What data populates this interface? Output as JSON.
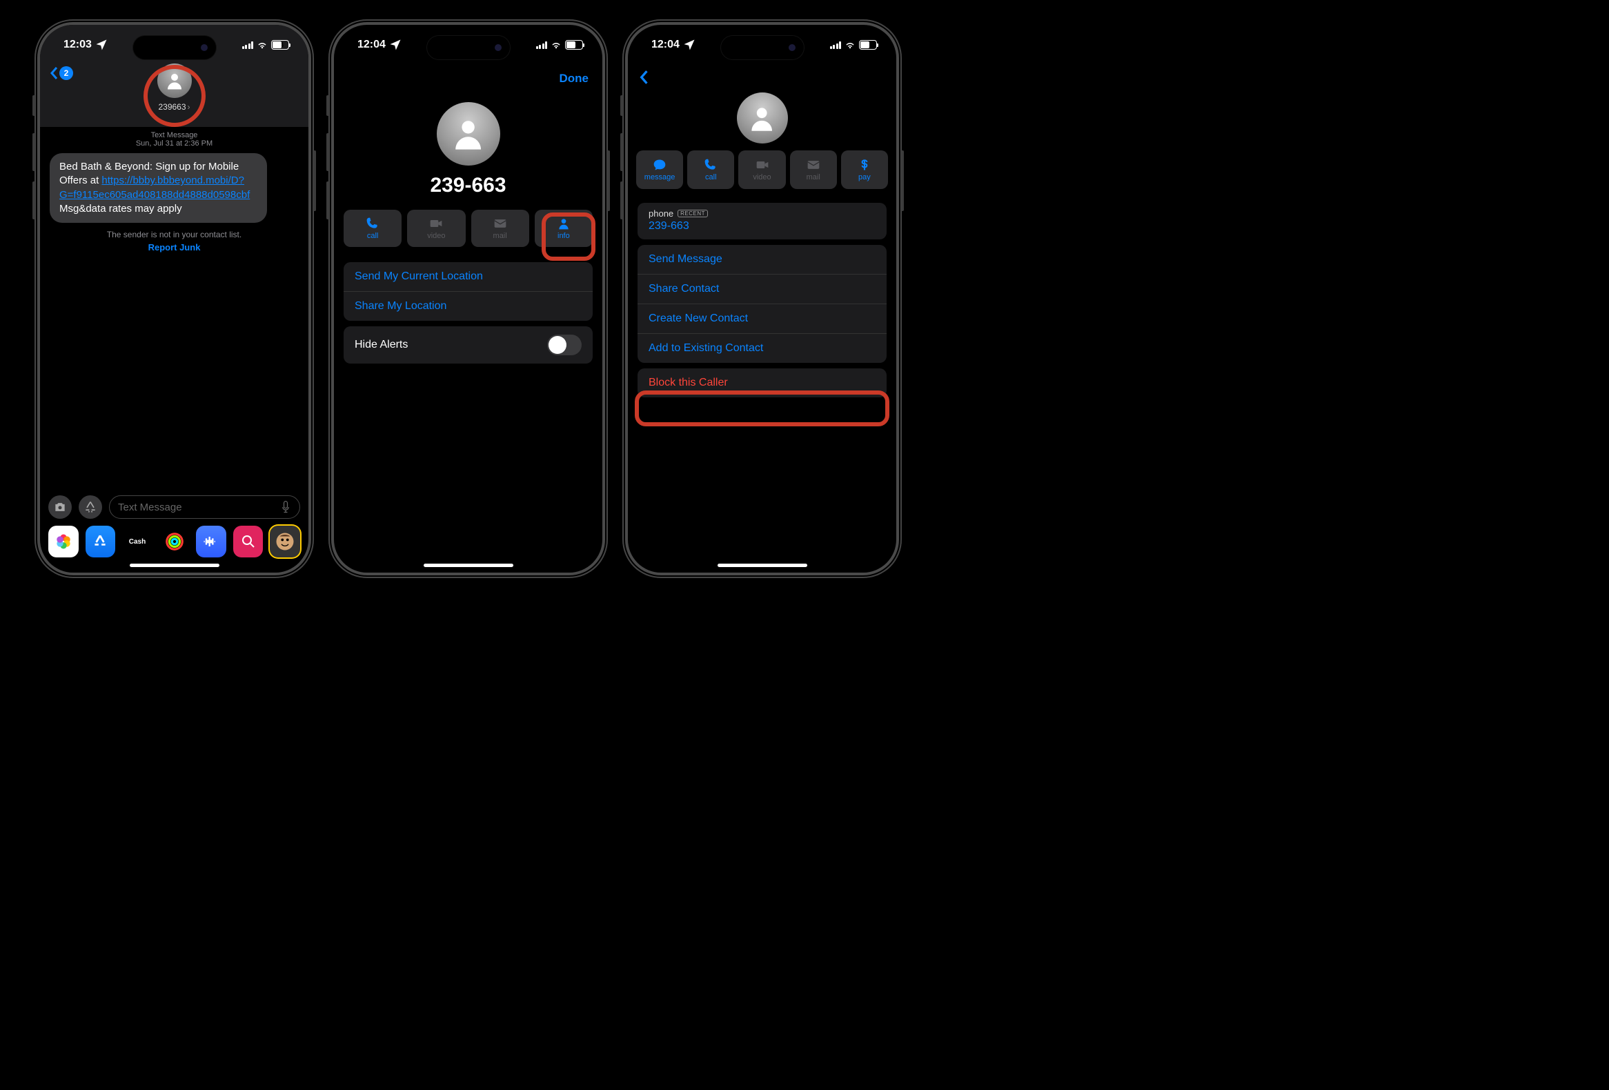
{
  "status": {
    "time1": "12:03",
    "time2": "12:04",
    "time3": "12:04",
    "battery": "54"
  },
  "s1": {
    "back_count": "2",
    "contact_name": "239663",
    "meta_line1": "Text Message",
    "meta_line2": "Sun, Jul 31 at 2:36 PM",
    "msg_pre": "Bed Bath & Beyond: Sign up for Mobile Offers at ",
    "msg_link1": "https://bbby.bbbeyond.mobi/D?G=f9115ec605ad408188dd4888d0598cbf",
    "msg_post": " Msg&data rates may apply",
    "sender_note": "The sender is not in your contact list.",
    "report_junk": "Report Junk",
    "compose_placeholder": "Text Message",
    "cash_label": "Cash"
  },
  "s2": {
    "done": "Done",
    "phone_display": "239-663",
    "actions": {
      "call": "call",
      "video": "video",
      "mail": "mail",
      "info": "info"
    },
    "send_location": "Send My Current Location",
    "share_location": "Share My Location",
    "hide_alerts": "Hide Alerts"
  },
  "s3": {
    "actions": {
      "message": "message",
      "call": "call",
      "video": "video",
      "mail": "mail",
      "pay": "pay"
    },
    "phone_label": "phone",
    "recent": "RECENT",
    "phone_value": "239-663",
    "send_message": "Send Message",
    "share_contact": "Share Contact",
    "create_contact": "Create New Contact",
    "add_existing": "Add to Existing Contact",
    "block": "Block this Caller"
  }
}
